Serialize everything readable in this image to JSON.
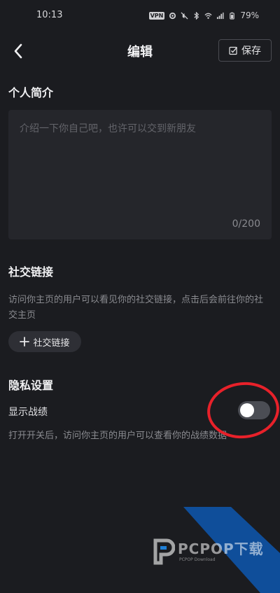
{
  "status_bar": {
    "time": "10:13",
    "vpn_label": "VPN",
    "battery_percent": "79%"
  },
  "header": {
    "title": "编辑",
    "save_label": "保存"
  },
  "bio": {
    "section_title": "个人简介",
    "placeholder": "介绍一下你自己吧，也许可以交到新朋友",
    "counter": "0/200"
  },
  "social": {
    "section_title": "社交链接",
    "description": "访问你主页的用户可以看见你的社交链接，点击后会前往你的社交主页",
    "add_label": "社交链接"
  },
  "privacy": {
    "section_title": "隐私设置",
    "show_record_label": "显示战绩",
    "show_record_enabled": false,
    "description": "打开开关后，访问你主页的用户可以查看你的战绩数据"
  },
  "watermark": {
    "brand": "PCPOP下载",
    "sub": "PCPOP Download"
  },
  "colors": {
    "background": "#1b1c20",
    "input_background": "#25262b",
    "annotation_red": "#e8212a",
    "watermark_blue": "#0f4e9a"
  }
}
